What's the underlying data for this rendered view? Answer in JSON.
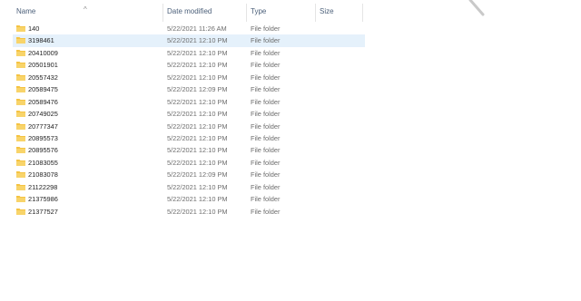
{
  "columns": {
    "name": "Name",
    "date_modified": "Date modified",
    "type": "Type",
    "size": "Size"
  },
  "folder_icon_color": "#f5c342",
  "selection_color": "#e5f1fb",
  "rows": [
    {
      "name": "140",
      "date": "5/22/2021 11:26 AM",
      "type": "File folder"
    },
    {
      "name": "3198461",
      "date": "5/22/2021 12:10 PM",
      "type": "File folder",
      "selected": true
    },
    {
      "name": "20410009",
      "date": "5/22/2021 12:10 PM",
      "type": "File folder"
    },
    {
      "name": "20501901",
      "date": "5/22/2021 12:10 PM",
      "type": "File folder"
    },
    {
      "name": "20557432",
      "date": "5/22/2021 12:10 PM",
      "type": "File folder"
    },
    {
      "name": "20589475",
      "date": "5/22/2021 12:09 PM",
      "type": "File folder"
    },
    {
      "name": "20589476",
      "date": "5/22/2021 12:10 PM",
      "type": "File folder"
    },
    {
      "name": "20749025",
      "date": "5/22/2021 12:10 PM",
      "type": "File folder"
    },
    {
      "name": "20777347",
      "date": "5/22/2021 12:10 PM",
      "type": "File folder"
    },
    {
      "name": "20895573",
      "date": "5/22/2021 12:10 PM",
      "type": "File folder"
    },
    {
      "name": "20895576",
      "date": "5/22/2021 12:10 PM",
      "type": "File folder"
    },
    {
      "name": "21083055",
      "date": "5/22/2021 12:10 PM",
      "type": "File folder"
    },
    {
      "name": "21083078",
      "date": "5/22/2021 12:09 PM",
      "type": "File folder"
    },
    {
      "name": "21122298",
      "date": "5/22/2021 12:10 PM",
      "type": "File folder"
    },
    {
      "name": "21375986",
      "date": "5/22/2021 12:10 PM",
      "type": "File folder"
    },
    {
      "name": "21377527",
      "date": "5/22/2021 12:10 PM",
      "type": "File folder"
    }
  ]
}
